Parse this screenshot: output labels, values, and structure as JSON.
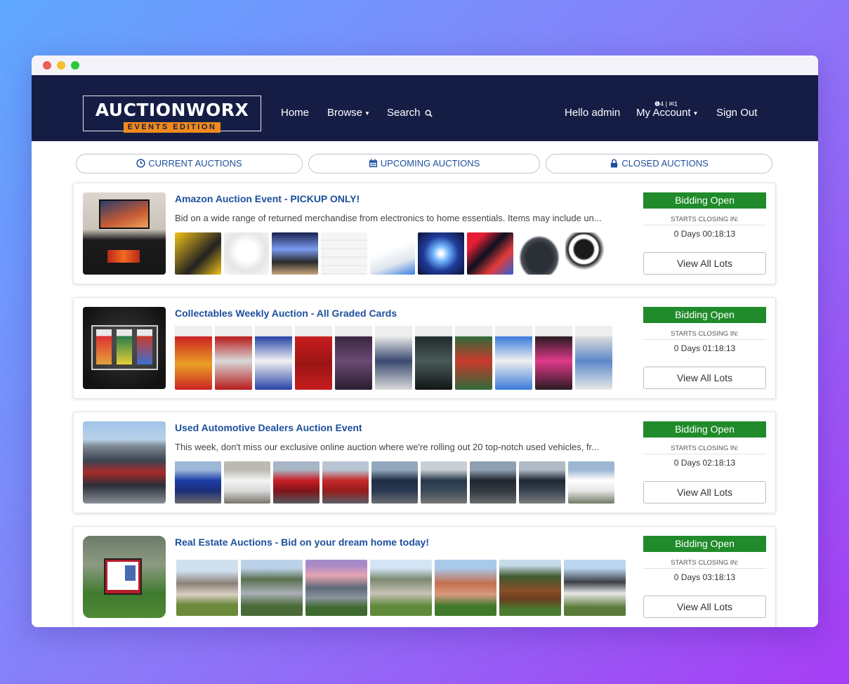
{
  "header": {
    "logo_main": "AUCTIONWORX",
    "logo_sub": "EVENTS EDITION",
    "nav": {
      "home": "Home",
      "browse": "Browse",
      "search": "Search",
      "greeting": "Hello admin",
      "account": "My Account",
      "signout": "Sign Out",
      "badge_alerts": "4",
      "badge_messages": "1"
    }
  },
  "tabs": [
    {
      "label": "CURRENT AUCTIONS",
      "icon": "clock-icon"
    },
    {
      "label": "UPCOMING AUCTIONS",
      "icon": "calendar-icon"
    },
    {
      "label": "CLOSED AUCTIONS",
      "icon": "lock-icon"
    }
  ],
  "auctions": [
    {
      "title": "Amazon Auction Event - PICKUP ONLY!",
      "description": "Bid on a wide range of returned merchandise from electronics to home essentials. Items may include un...",
      "status": "Bidding Open",
      "closing_label": "STARTS CLOSING IN:",
      "closing_time": "0 Days 00:18:13",
      "button": "View All Lots"
    },
    {
      "title": "Collectables Weekly Auction - All Graded Cards",
      "description": "",
      "status": "Bidding Open",
      "closing_label": "STARTS CLOSING IN:",
      "closing_time": "0 Days 01:18:13",
      "button": "View All Lots"
    },
    {
      "title": "Used Automotive Dealers Auction Event",
      "description": "This week, don't miss our exclusive online auction where we're rolling out 20 top-notch used vehicles, fr...",
      "status": "Bidding Open",
      "closing_label": "STARTS CLOSING IN:",
      "closing_time": "0 Days 02:18:13",
      "button": "View All Lots"
    },
    {
      "title": "Real Estate Auctions - Bid on your dream home today!",
      "description": "",
      "status": "Bidding Open",
      "closing_label": "STARTS CLOSING IN:",
      "closing_time": "0 Days 03:18:13",
      "button": "View All Lots"
    }
  ],
  "colors": {
    "navbar": "#161d45",
    "accent_orange": "#f08a1c",
    "status_green": "#1f8b2a",
    "link_blue": "#1d4f9c"
  }
}
